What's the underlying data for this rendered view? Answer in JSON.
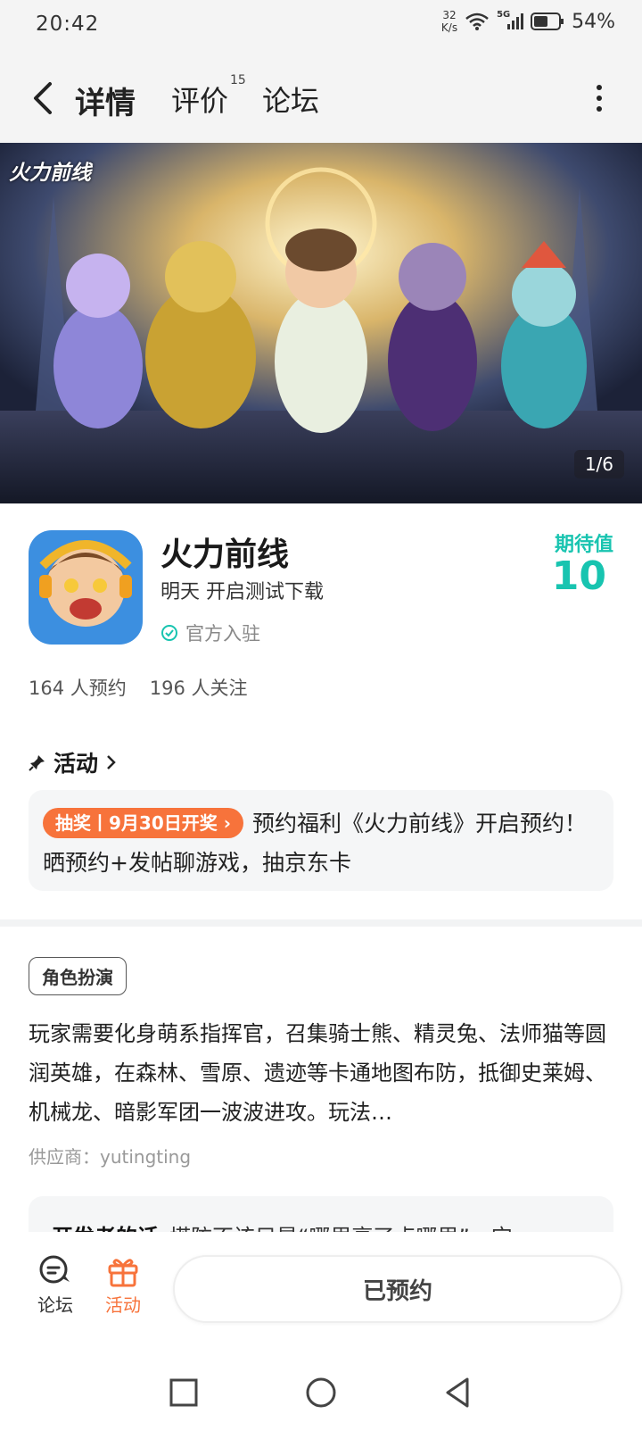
{
  "status_bar": {
    "time": "20:42",
    "net_speed_value": "32",
    "net_speed_unit": "K/s",
    "network": "5G",
    "battery": "54%"
  },
  "nav": {
    "tabs": [
      {
        "label": "详情",
        "active": true
      },
      {
        "label": "评价",
        "badge": "15"
      },
      {
        "label": "论坛"
      }
    ]
  },
  "banner": {
    "logo_text": "火力前线",
    "counter": "1/6"
  },
  "game": {
    "title": "火力前线",
    "status": "明天 开启测试下载",
    "official_label": "官方入驻",
    "expect_label": "期待值",
    "expect_value": "10",
    "reservations": "164 人预约",
    "followers": "196 人关注"
  },
  "activity": {
    "header": "活动",
    "badge": "抽奖丨9月30日开奖",
    "text": "预约福利《火力前线》开启预约！晒预约+发帖聊游戏，抽京东卡"
  },
  "details": {
    "tag": "角色扮演",
    "description": "玩家需要化身萌系指挥官，召集骑士熊、精灵兔、法师猫等圆润英雄，在森林、雪原、遗迹等卡通地图布防，抵御史莱姆、机械龙、暗影军团一波波进攻。玩法…",
    "supplier": "供应商：yutingting",
    "dev_label": "开发者的话",
    "dev_text": "塔防不该只是“哪里亮了点哪里”，它"
  },
  "bottom_bar": {
    "forum_label": "论坛",
    "activity_label": "活动",
    "reserved_label": "已预约"
  },
  "colors": {
    "accent": "#18c4b0",
    "badge_orange": "#f7733b",
    "active_bottom": "#f7733b"
  }
}
